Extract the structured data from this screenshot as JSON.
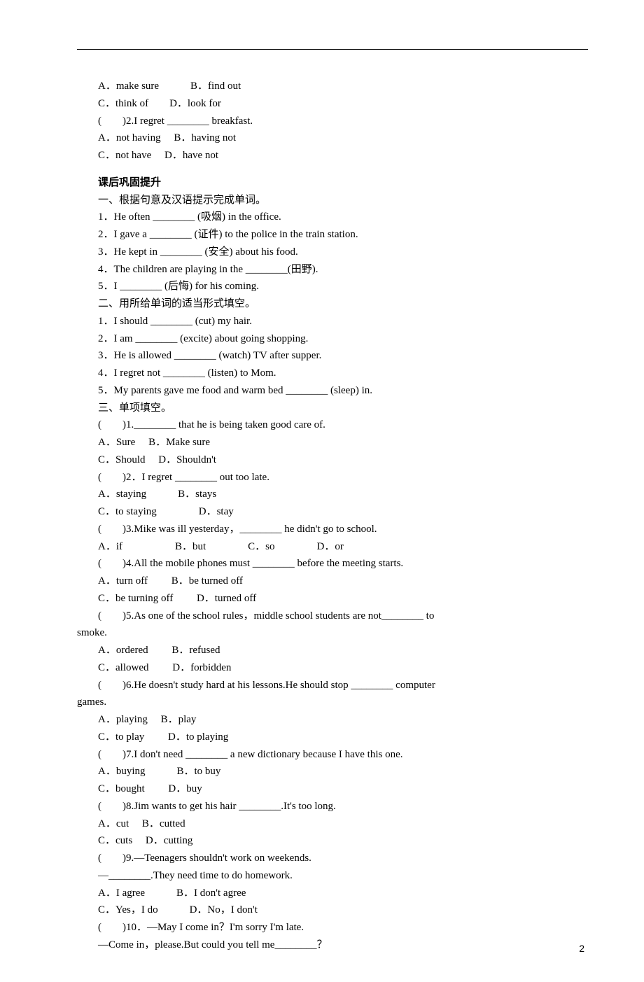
{
  "top": {
    "q1_opts_ab": "A．make sure　　　B．find out",
    "q1_opts_cd": "C．think of　　D．look for",
    "q2_stem": "(　　)2.I regret ________ breakfast.",
    "q2_opts_ab": "A．not having　 B．having not",
    "q2_opts_cd": "C．not have　 D．have not"
  },
  "section_title": "课后巩固提升",
  "s1": {
    "heading": "一、根据句意及汉语提示完成单词。",
    "q1": "1．He often ________ (吸烟) in the office.",
    "q2": "2．I gave a ________ (证件) to the police in the train station.",
    "q3": "3．He kept in ________ (安全) about his food.",
    "q4": "4．The children are playing in the ________(田野).",
    "q5": "5．I ________ (后悔) for his coming."
  },
  "s2": {
    "heading": "二、用所给单词的适当形式填空。",
    "q1": "1．I should ________ (cut) my hair.",
    "q2": "2．I am ________ (excite) about going shopping.",
    "q3": "3．He is allowed ________ (watch) TV after supper.",
    "q4": "4．I regret not ________ (listen) to Mom.",
    "q5": "5．My parents gave me food and warm bed ________ (sleep) in."
  },
  "s3": {
    "heading": "三、单项填空。",
    "q1_stem": "(　　)1.________ that he is being taken good care of.",
    "q1_ab": "A．Sure　 B．Make sure",
    "q1_cd": "C．Should　 D．Shouldn't",
    "q2_stem": "(　　)2．I regret ________ out too late.",
    "q2_ab": "A．staying　　　B．stays",
    "q2_cd": "C．to staying　　　　D．stay",
    "q3_stem": "(　　)3.Mike was ill yesterday，________ he didn't go to school.",
    "q3_opts": "A．if　　　　　B．but　　　　C．so　　　　D．or",
    "q4_stem": "(　　)4.All the mobile phones must ________ before the meeting starts.",
    "q4_ab": "A．turn off　　 B．be turned off",
    "q4_cd": "C．be turning off　　 D．turned off",
    "q5_stem_a": "(　　)5.As one of the school rules，middle school students are not________ to ",
    "q5_stem_b": "smoke.",
    "q5_ab": "A．ordered　　 B．refused",
    "q5_cd": "C．allowed　　 D．forbidden",
    "q6_stem_a": "(　　)6.He doesn't study hard at his lessons.He should stop ________ computer ",
    "q6_stem_b": "games.",
    "q6_ab": "A．playing　 B．play",
    "q6_cd": "C．to play　　 D．to playing",
    "q7_stem": "(　　)7.I don't need ________ a new dictionary because I have this one.",
    "q7_ab": "A．buying　　　B．to buy",
    "q7_cd": "C．bought　　 D．buy",
    "q8_stem": "(　　)8.Jim wants to get his hair ________.It's too long.",
    "q8_ab": "A．cut　 B．cutted",
    "q8_cd": "C．cuts　 D．cutting",
    "q9_stem": "(　　)9.—Teenagers shouldn't work on weekends.",
    "q9_resp": "—________.They need time to do homework.",
    "q9_ab": "A．I agree　　　B．I don't agree",
    "q9_cd": "C．Yes，I do　　　D．No，I don't",
    "q10_stem": "(　　)10．—May I come in？I'm sorry I'm late.",
    "q10_resp": "—Come in，please.But could you tell me________？"
  },
  "page_num": "2"
}
